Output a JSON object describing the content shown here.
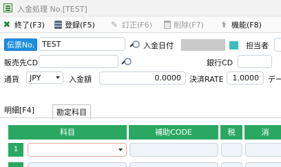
{
  "window": {
    "title": "入金処理 No.[TEST]"
  },
  "toolbar": {
    "exit": "終了(F3)",
    "register": "登録(F5)",
    "correct": "訂正(F6)",
    "delete": "削除(F7)",
    "function": "機能(F8)"
  },
  "form": {
    "slip_no_label": "伝票No.",
    "slip_no_value": "TEST",
    "deposit_date_label": "入金日付",
    "staff_label": "担当者",
    "customer_cd_label": "販売先CD",
    "bank_cd_label": "銀行CD",
    "currency_label": "通貨",
    "currency_value": "JPY",
    "amount_label": "入金額",
    "amount_value": "0.0000",
    "rate_label": "決済RATE",
    "rate_value": "1.0000",
    "truncated_label": "デー"
  },
  "tabs": {
    "detail": "明細[F4]",
    "account": "勘定科目"
  },
  "grid": {
    "headers": [
      "科目",
      "補助CODE",
      "税",
      "消"
    ],
    "rows": [
      {
        "num": "1"
      }
    ]
  },
  "colors": {
    "accent_green": "#2aa862",
    "label_blue": "#1d8fe1",
    "teal": "#3cbdbd"
  }
}
